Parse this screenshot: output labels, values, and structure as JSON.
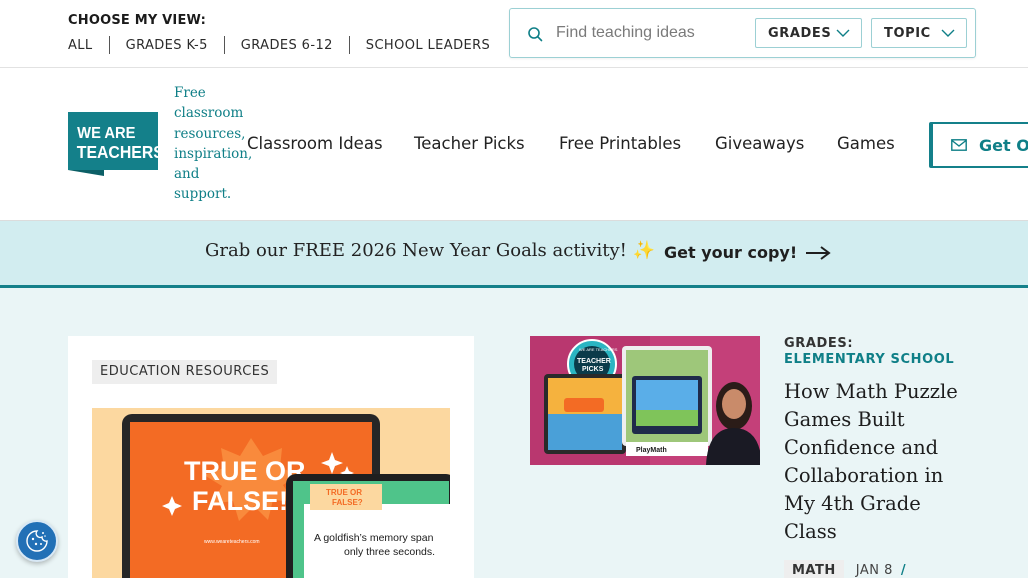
{
  "topbar": {
    "view_label": "CHOOSE MY VIEW:",
    "view_links": [
      "ALL",
      "GRADES K-5",
      "GRADES 6-12",
      "SCHOOL LEADERS"
    ],
    "search": {
      "placeholder": "Find teaching ideas",
      "value": ""
    },
    "grades_dropdown": "GRADES",
    "topic_dropdown": "TOPIC"
  },
  "header": {
    "logo_text": [
      "WE ARE",
      "TEACHERS"
    ],
    "tagline": "Free classroom resources, inspiration, and support.",
    "nav": [
      "Classroom Ideas",
      "Teacher Picks",
      "Free Printables",
      "Giveaways",
      "Games"
    ],
    "cta_label": "Get Our"
  },
  "banner": {
    "text": "Grab our FREE 2026 New Year Goals activity!",
    "sparkle": "✨",
    "link": "Get your copy!"
  },
  "featured": {
    "tag": "EDUCATION RESOURCES",
    "image": {
      "headline": "TRUE OR FALSE!",
      "small_label": "TRUE OR FALSE?",
      "quiz_text": "A goldfish's memory span only three seconds.",
      "url_caption": "www.weareteachers.com"
    }
  },
  "article": {
    "grades_label": "GRADES:",
    "grades_value": "ELEMENTARY SCHOOL",
    "title": "How Math Puzzle Games Built Confidence and Collaboration in My 4th Grade Class",
    "subject": "MATH",
    "date": "JAN 8",
    "separator": "/",
    "thumb": {
      "badge_top": "WE ARE TEACHERS",
      "badge_main": "TEACHER PICKS",
      "badge_year": "2026",
      "brand": "PlayMath"
    }
  },
  "colors": {
    "brand_teal": "#14808a",
    "banner_bg": "#d2edf0",
    "page_bg": "#eaf5f6"
  },
  "icons": [
    "search-icon",
    "chevron-down-icon",
    "mail-icon",
    "arrow-right-icon",
    "cookie-icon"
  ]
}
